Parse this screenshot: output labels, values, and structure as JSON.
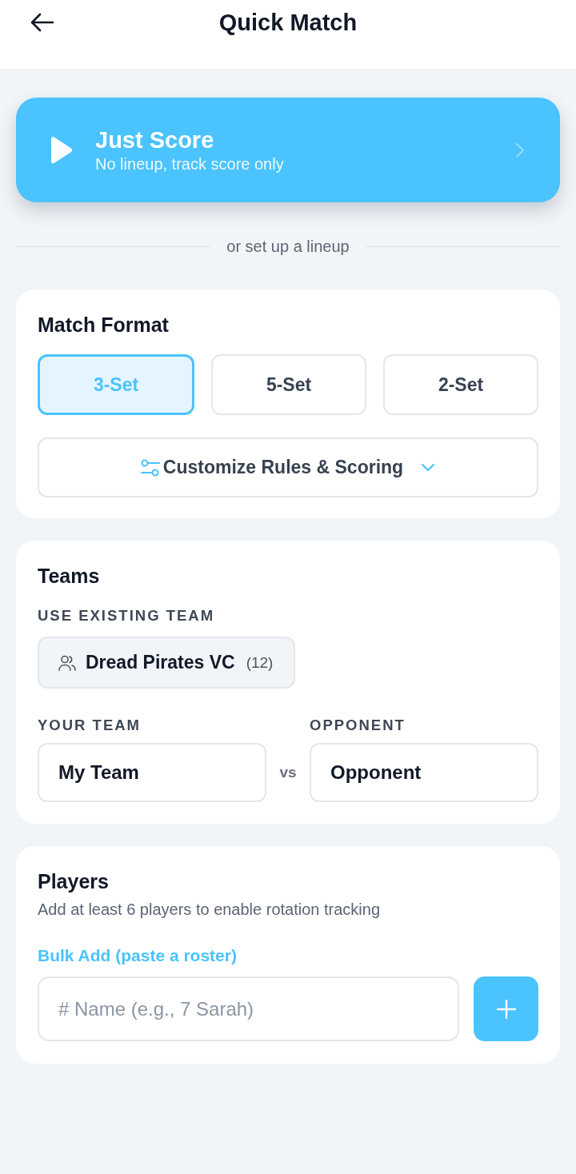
{
  "header": {
    "title": "Quick Match"
  },
  "quick_start": {
    "title": "Just Score",
    "subtitle": "No lineup, track score only"
  },
  "divider": {
    "label": "or set up a lineup"
  },
  "match_format": {
    "title": "Match Format",
    "options": [
      {
        "label": "3-Set",
        "selected": true
      },
      {
        "label": "5-Set",
        "selected": false
      },
      {
        "label": "2-Set",
        "selected": false
      }
    ],
    "customize": {
      "label": "Customize Rules & Scoring",
      "expanded": false
    }
  },
  "teams": {
    "title": "Teams",
    "existing_label": "USE EXISTING TEAM",
    "existing_teams": [
      {
        "name": "Dread Pirates VC",
        "count": "(12)"
      }
    ],
    "your_team": {
      "label": "YOUR TEAM",
      "value": "My Team"
    },
    "vs": "vs",
    "opponent": {
      "label": "OPPONENT",
      "value": "Opponent"
    }
  },
  "players": {
    "title": "Players",
    "hint": "Add at least 6 players to enable rotation tracking",
    "bulk_add": "Bulk Add (paste a roster)",
    "input": {
      "placeholder": "# Name (e.g., 7 Sarah)"
    }
  }
}
